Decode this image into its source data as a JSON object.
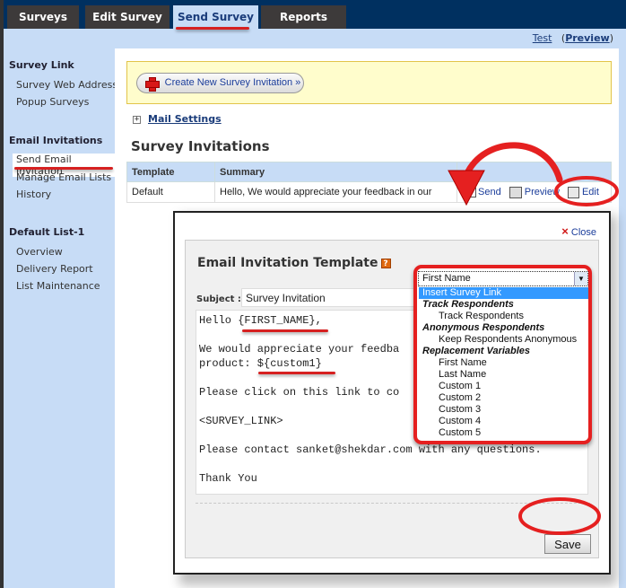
{
  "nav": {
    "tabs": [
      {
        "label": "Surveys",
        "active": false
      },
      {
        "label": "Edit Survey",
        "active": false
      },
      {
        "label": "Send Survey",
        "active": true
      },
      {
        "label": "Reports",
        "active": false
      }
    ]
  },
  "toplinks": {
    "test": "Test",
    "preview_open": "(",
    "preview": "Preview",
    "preview_close": ")"
  },
  "sidebar": {
    "sections": [
      {
        "title": "Survey Link",
        "items": [
          "Survey Web Address",
          "Popup Surveys"
        ]
      },
      {
        "title": "Email Invitations",
        "items": [
          "Send Email Invitation",
          "Manage Email Lists",
          "History"
        ]
      },
      {
        "title": "Default List-1",
        "items": [
          "Overview",
          "Delivery Report",
          "List Maintenance"
        ]
      }
    ],
    "active_item": "Send Email Invitation"
  },
  "main": {
    "create_button": "Create New Survey Invitation »",
    "mail_settings_expander": "+",
    "mail_settings": "Mail Settings",
    "section_title": "Survey Invitations",
    "table": {
      "headers": [
        "Template",
        "Summary",
        ""
      ],
      "rows": [
        {
          "template": "Default",
          "summary": "Hello, We would appreciate your feedback in our",
          "actions": {
            "send": "Send",
            "preview": "Preview",
            "edit": "Edit"
          }
        }
      ]
    }
  },
  "modal": {
    "close_label": "Close",
    "close_icon": "×",
    "title": "Email Invitation Template",
    "help_icon": "?",
    "subject_label": "Subject :",
    "subject_value": "Survey Invitation",
    "body": "Hello {FIRST_NAME},\n\nWe would appreciate your feedba\nproduct: ${custom1}\n\nPlease click on this link to co\n\n<SURVEY_LINK>\n\nPlease contact sanket@shekdar.com with any questions.\n\nThank You",
    "save_label": "Save",
    "insert_dropdown": {
      "selected": "First Name",
      "arrow": "▼",
      "options": [
        {
          "type": "option",
          "label": "Insert Survey Link",
          "highlighted": true
        },
        {
          "type": "group",
          "label": "Track Respondents"
        },
        {
          "type": "option",
          "label": "Track Respondents"
        },
        {
          "type": "group",
          "label": "Anonymous Respondents"
        },
        {
          "type": "option",
          "label": "Keep Respondents Anonymous"
        },
        {
          "type": "group",
          "label": "Replacement Variables"
        },
        {
          "type": "option",
          "label": "First Name"
        },
        {
          "type": "option",
          "label": "Last Name"
        },
        {
          "type": "option",
          "label": "Custom 1"
        },
        {
          "type": "option",
          "label": "Custom 2"
        },
        {
          "type": "option",
          "label": "Custom 3"
        },
        {
          "type": "option",
          "label": "Custom 4"
        },
        {
          "type": "option",
          "label": "Custom 5"
        }
      ]
    }
  },
  "annotation_color": "#e52020"
}
